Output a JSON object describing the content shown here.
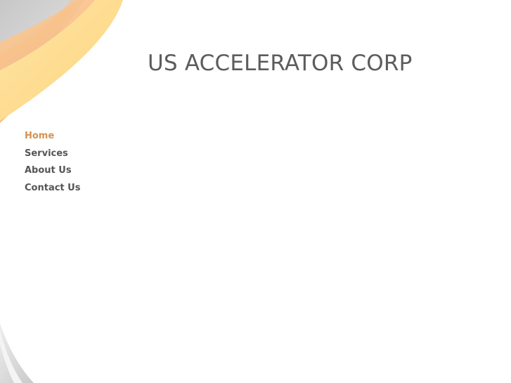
{
  "header": {
    "title": "US ACCELERATOR CORP"
  },
  "nav": {
    "items": [
      {
        "label": "Home",
        "active": true
      },
      {
        "label": "Services",
        "active": false
      },
      {
        "label": "About Us",
        "active": false
      },
      {
        "label": "Contact Us",
        "active": false
      }
    ]
  },
  "colors": {
    "background": "#ffffff",
    "title": "#5c5c5c",
    "nav_text": "#555555",
    "nav_active": "#d4924f",
    "swoosh_yellow": "#fedb86",
    "swoosh_orange": "#f8b27a",
    "swoosh_gray": "#cfcfcf"
  }
}
